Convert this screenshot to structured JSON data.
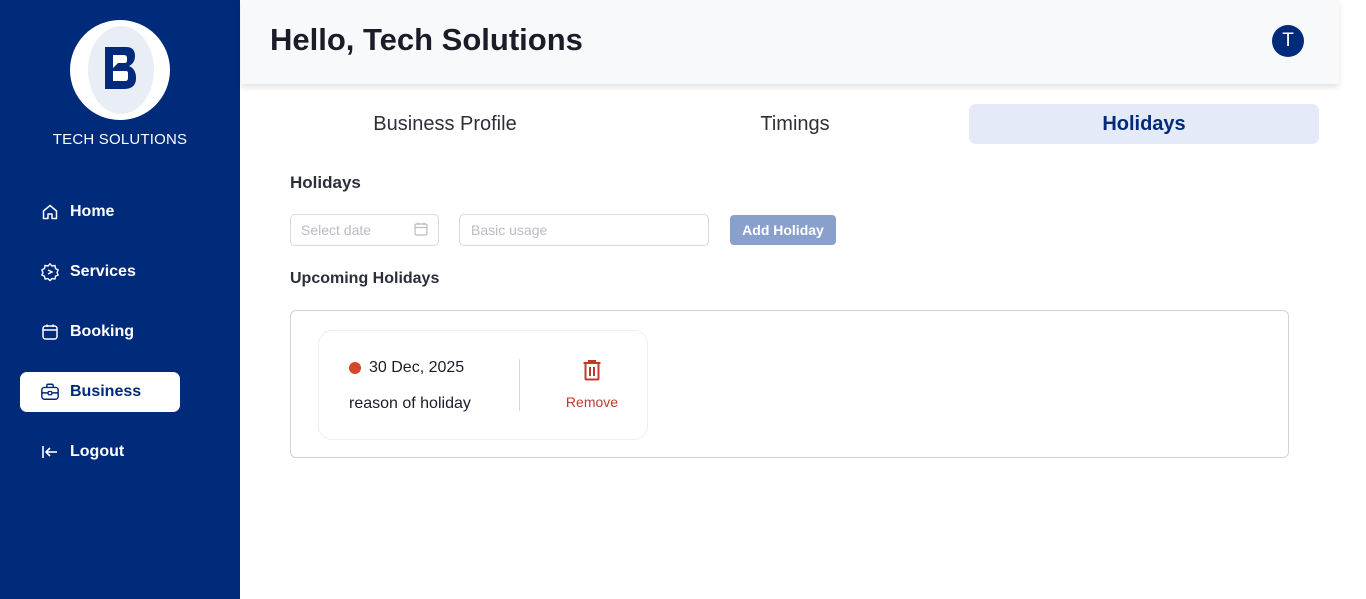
{
  "sidebar": {
    "brand": "TECH SOLUTIONS",
    "items": [
      {
        "label": "Home",
        "icon": "home-icon"
      },
      {
        "label": "Services",
        "icon": "services-gear-icon"
      },
      {
        "label": "Booking",
        "icon": "calendar-icon"
      },
      {
        "label": "Business",
        "icon": "briefcase-icon",
        "active": true
      },
      {
        "label": "Logout",
        "icon": "logout-icon"
      }
    ]
  },
  "header": {
    "title": "Hello, Tech Solutions",
    "avatar_initial": "T"
  },
  "tabs": [
    {
      "label": "Business Profile"
    },
    {
      "label": "Timings"
    },
    {
      "label": "Holidays",
      "active": true
    }
  ],
  "holidays": {
    "section_title": "Holidays",
    "date_placeholder": "Select date",
    "reason_placeholder": "Basic usage",
    "add_button": "Add Holiday",
    "upcoming_title": "Upcoming Holidays",
    "list": [
      {
        "date": "30 Dec, 2025",
        "reason": "reason of holiday",
        "remove_label": "Remove"
      }
    ]
  },
  "colors": {
    "primary": "#002a7a",
    "active_tab_bg": "#e4eaf7",
    "add_button_bg": "#8aa0cc",
    "danger": "#c0392b",
    "dot": "#d1492a"
  }
}
